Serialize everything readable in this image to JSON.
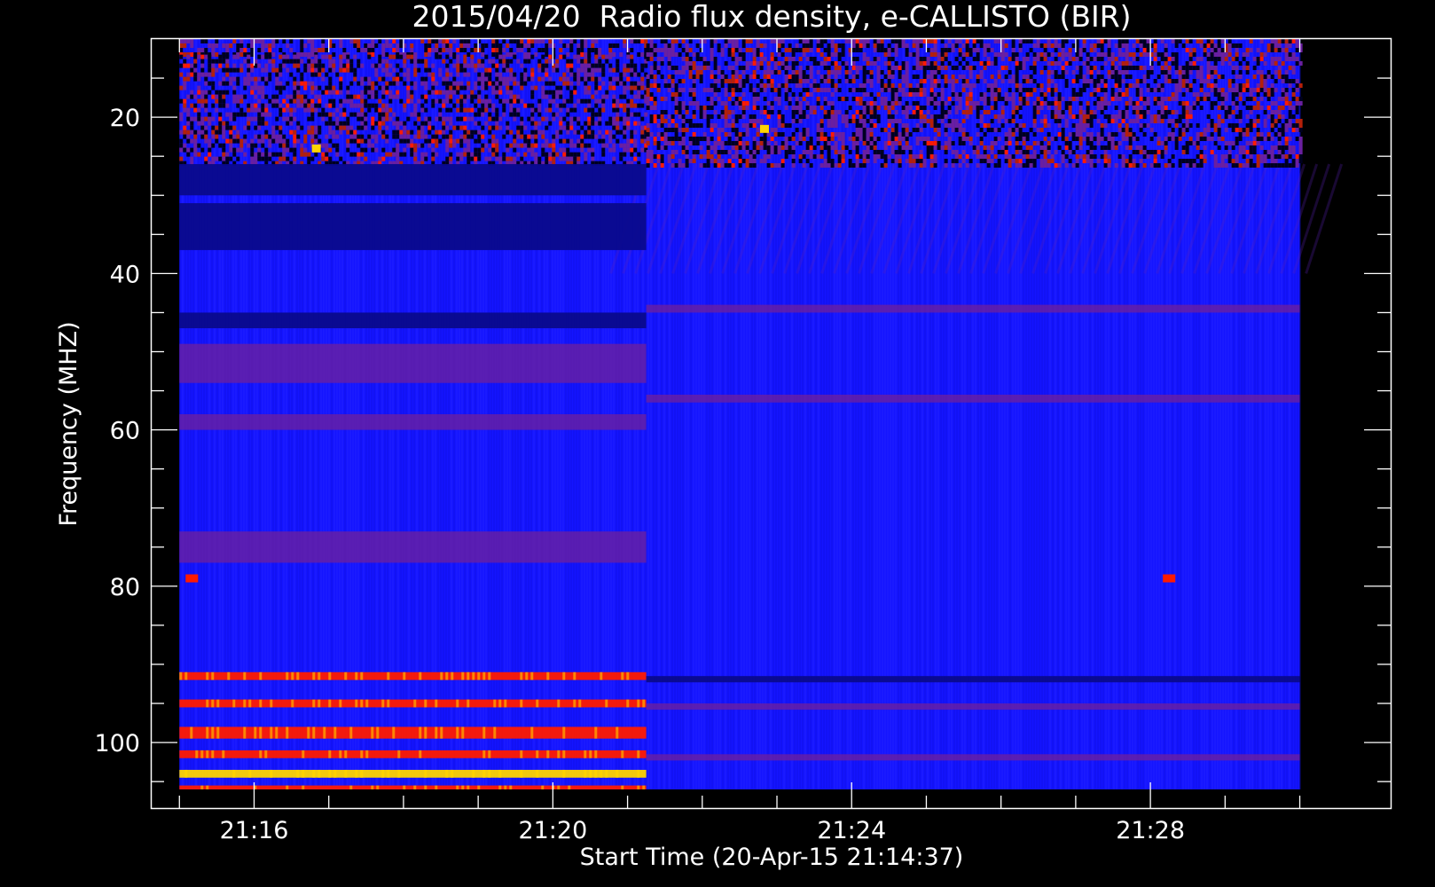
{
  "chart_data": {
    "type": "heatmap",
    "title": "2015/04/20  Radio flux density, e-CALLISTO (BIR)",
    "xlabel": "Start Time (20-Apr-15 21:14:37)",
    "ylabel": "Frequency (MHZ)",
    "x_ticks": [
      "21:16",
      "21:20",
      "21:24",
      "21:28"
    ],
    "y_ticks": [
      "20",
      "40",
      "60",
      "80",
      "100"
    ],
    "xlim": [
      "21:14:37",
      "21:31:13"
    ],
    "ylim": [
      108.5,
      10
    ],
    "data_extent": {
      "time": [
        "21:15:00",
        "21:30:00"
      ],
      "frequency_mhz": [
        10,
        106
      ]
    },
    "instrument_change_time": "21:21:15",
    "colors": {
      "background": "#000000",
      "low": "#1414ff",
      "mid": "#6a1fa0",
      "high": "#ff1a00",
      "peak": "#ffd400"
    },
    "bands_left": [
      {
        "freq": [
          10,
          12
        ],
        "level": "noise"
      },
      {
        "freq": [
          12,
          26
        ],
        "level": "noise"
      },
      {
        "freq": [
          26,
          30
        ],
        "level": "dark"
      },
      {
        "freq": [
          31,
          37
        ],
        "level": "dark"
      },
      {
        "freq": [
          45,
          47
        ],
        "level": "dark"
      },
      {
        "freq": [
          49,
          54
        ],
        "level": "mid"
      },
      {
        "freq": [
          58,
          60
        ],
        "level": "mid"
      },
      {
        "freq": [
          73,
          77
        ],
        "level": "mid"
      },
      {
        "freq": [
          91,
          92
        ],
        "level": "high"
      },
      {
        "freq": [
          94.5,
          95.5
        ],
        "level": "high"
      },
      {
        "freq": [
          98,
          99.5
        ],
        "level": "high"
      },
      {
        "freq": [
          101,
          102
        ],
        "level": "high"
      },
      {
        "freq": [
          103.5,
          104.5
        ],
        "level": "peak"
      },
      {
        "freq": [
          105.5,
          106
        ],
        "level": "high"
      }
    ],
    "bands_right": [
      {
        "freq": [
          10,
          26
        ],
        "level": "noise"
      },
      {
        "freq": [
          44,
          45
        ],
        "level": "mid"
      },
      {
        "freq": [
          55.5,
          56.5
        ],
        "level": "mid"
      },
      {
        "freq": [
          91.5,
          92.3
        ],
        "level": "dark"
      },
      {
        "freq": [
          95,
          95.8
        ],
        "level": "mid"
      },
      {
        "freq": [
          101.5,
          102.3
        ],
        "level": "mid"
      }
    ],
    "spots": [
      {
        "time": "21:15:10",
        "freq": 79,
        "level": "high"
      },
      {
        "time": "21:28:15",
        "freq": 79,
        "level": "high"
      },
      {
        "time": "21:16:50",
        "freq": 24,
        "level": "peak"
      },
      {
        "time": "21:22:50",
        "freq": 21.5,
        "level": "peak"
      }
    ]
  }
}
